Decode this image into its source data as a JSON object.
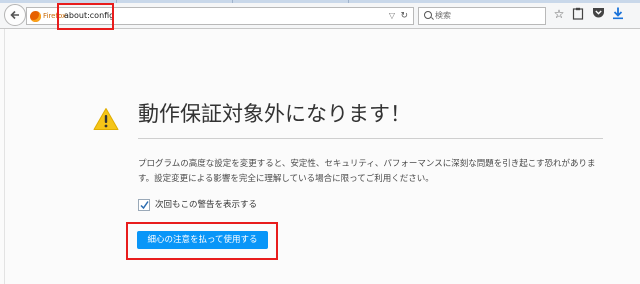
{
  "toolbar": {
    "identity_label": "Firefox",
    "url": "about:config",
    "search_placeholder": "検索"
  },
  "icons": {
    "back": "back-arrow-icon",
    "firefox": "firefox-icon",
    "dropdown": "chevron-down-icon",
    "reload": "reload-icon",
    "search": "search-icon",
    "bookmark": "star-icon",
    "reading_list": "clipboard-icon",
    "pocket": "pocket-icon",
    "downloads": "download-icon",
    "warning": "warning-icon"
  },
  "page": {
    "title": "動作保証対象外になります！",
    "description": "プログラムの高度な設定を変更すると、安定性、セキュリティ、パフォーマンスに深刻な問題を引き起こす恐れがあります。設定変更による影響を完全に理解している場合に限ってご利用ください。",
    "checkbox_label": "次回もこの警告を表示する",
    "checkbox_checked": true,
    "accept_button": "細心の注意を払って使用する"
  },
  "colors": {
    "accent_button": "#0996f8",
    "warning": "#f5c518",
    "highlight": "#e81c1c"
  }
}
